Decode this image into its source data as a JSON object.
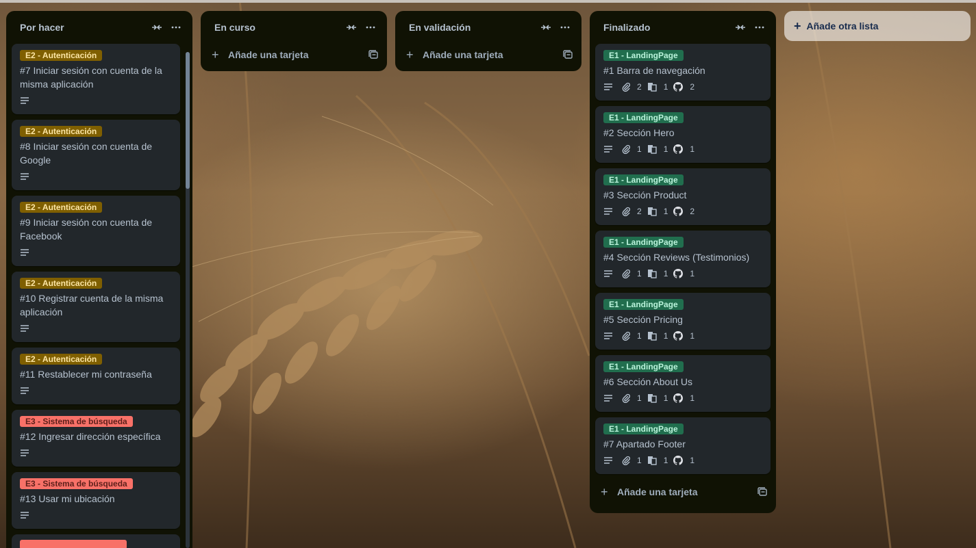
{
  "board": {
    "lists": [
      {
        "title": "Por hacer",
        "cards": [
          {
            "label": "E2 - Autenticación",
            "title": "#7 Iniciar sesión con cuenta de la misma aplicación"
          },
          {
            "label": "E2 - Autenticación",
            "title": "#8 Iniciar sesión con cuenta de Google"
          },
          {
            "label": "E2 - Autenticación",
            "title": "#9 Iniciar sesión con cuenta de Facebook"
          },
          {
            "label": "E2 - Autenticación",
            "title": "#10 Registrar cuenta de la misma aplicación"
          },
          {
            "label": "E2 - Autenticación",
            "title": "#11 Restablecer mi contraseña"
          },
          {
            "label": "E3 - Sistema de búsqueda",
            "title": "#12 Ingresar dirección específica"
          },
          {
            "label": "E3 - Sistema de búsqueda",
            "title": "#13 Usar mi ubicación"
          }
        ]
      },
      {
        "title": "En curso",
        "add_card": "Añade una tarjeta"
      },
      {
        "title": "En validación",
        "add_card": "Añade una tarjeta"
      },
      {
        "title": "Finalizado",
        "add_card": "Añade una tarjeta",
        "cards": [
          {
            "label": "E1 - LandingPage",
            "title": "#1 Barra de navegación",
            "attachments": "2",
            "checklist": "1",
            "github": "2"
          },
          {
            "label": "E1 - LandingPage",
            "title": "#2 Sección Hero",
            "attachments": "1",
            "checklist": "1",
            "github": "1"
          },
          {
            "label": "E1 - LandingPage",
            "title": "#3 Sección Product",
            "attachments": "2",
            "checklist": "1",
            "github": "2"
          },
          {
            "label": "E1 - LandingPage",
            "title": "#4 Sección Reviews (Testimonios)",
            "attachments": "1",
            "checklist": "1",
            "github": "1"
          },
          {
            "label": "E1 - LandingPage",
            "title": "#5 Sección Pricing",
            "attachments": "1",
            "checklist": "1",
            "github": "1"
          },
          {
            "label": "E1 - LandingPage",
            "title": "#6 Sección About Us",
            "attachments": "1",
            "checklist": "1",
            "github": "1"
          },
          {
            "label": "E1 - LandingPage",
            "title": "#7 Apartado Footer",
            "attachments": "1",
            "checklist": "1",
            "github": "1"
          }
        ]
      }
    ],
    "add_list": "Añade otra lista"
  },
  "colors": {
    "list_bg": "#101204",
    "card_bg": "#22272b",
    "label_e2": "#7f5f01",
    "label_e3": "#f87168",
    "label_e1": "#216e4e"
  },
  "icons": {
    "collapse": "collapse-arrows-icon",
    "more": "ellipsis-icon",
    "description": "description-lines-icon",
    "attachment": "paperclip-icon",
    "checklist": "document-icon",
    "github": "github-icon",
    "template": "card-template-icon"
  }
}
